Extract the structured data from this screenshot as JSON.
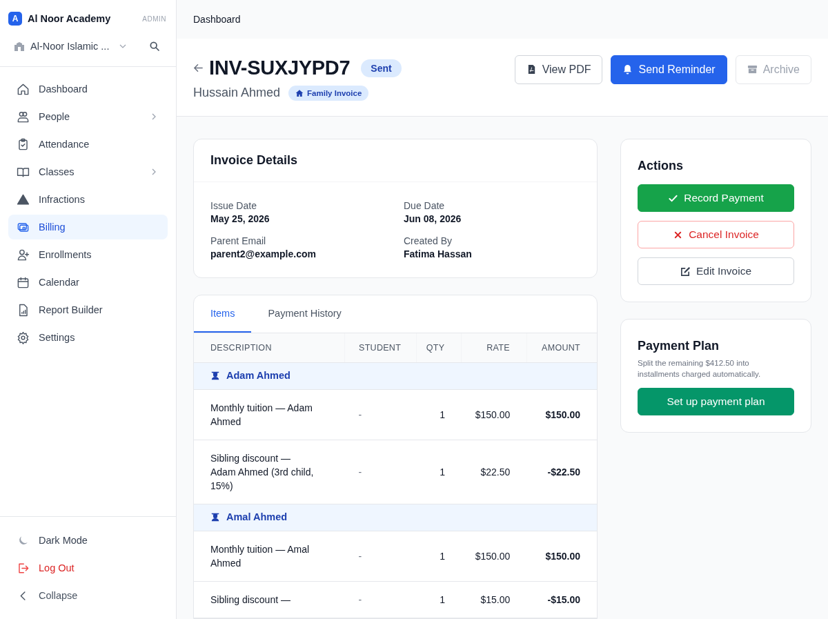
{
  "brand": {
    "logo": "A",
    "name": "Al Noor Academy",
    "role": "ADMIN"
  },
  "school": {
    "name": "Al-Noor Islamic ..."
  },
  "nav": [
    {
      "label": "Dashboard",
      "selected": false,
      "submenu": false
    },
    {
      "label": "People",
      "selected": false,
      "submenu": true
    },
    {
      "label": "Attendance",
      "selected": false,
      "submenu": false
    },
    {
      "label": "Classes",
      "selected": false,
      "submenu": true
    },
    {
      "label": "Infractions",
      "selected": false,
      "submenu": false
    },
    {
      "label": "Billing",
      "selected": true,
      "submenu": false
    },
    {
      "label": "Enrollments",
      "selected": false,
      "submenu": false
    },
    {
      "label": "Calendar",
      "selected": false,
      "submenu": false
    },
    {
      "label": "Report Builder",
      "selected": false,
      "submenu": false
    },
    {
      "label": "Settings",
      "selected": false,
      "submenu": false
    }
  ],
  "footer_nav": [
    {
      "label": "Dark Mode",
      "kind": "normal"
    },
    {
      "label": "Log Out",
      "kind": "danger"
    },
    {
      "label": "Collapse",
      "kind": "muted"
    }
  ],
  "breadcrumb": "Dashboard",
  "invoice": {
    "number": "INV-SUXJYPD7",
    "status": "Sent",
    "customer": "Hussain Ahmed",
    "type_badge": "Family Invoice"
  },
  "header_actions": [
    {
      "label": "View PDF",
      "kind": "outline",
      "disabled": false
    },
    {
      "label": "Send Reminder",
      "kind": "primary",
      "disabled": false
    },
    {
      "label": "Archive",
      "kind": "outline",
      "disabled": true
    }
  ],
  "details": {
    "title": "Invoice Details",
    "fields": [
      {
        "label": "Issue Date",
        "value": "May 25, 2026"
      },
      {
        "label": "Due Date",
        "value": "Jun 08, 2026"
      },
      {
        "label": "Parent Email",
        "value": "parent2@example.com"
      },
      {
        "label": "Created By",
        "value": "Fatima Hassan"
      }
    ]
  },
  "tabs": [
    {
      "label": "Items",
      "selected": true
    },
    {
      "label": "Payment History",
      "selected": false
    }
  ],
  "table": {
    "columns": [
      "DESCRIPTION",
      "STUDENT",
      "QTY",
      "RATE",
      "AMOUNT"
    ],
    "groups": [
      {
        "student": "Adam Ahmed",
        "rows": [
          {
            "description": "Monthly tuition — Adam Ahmed",
            "student": "-",
            "qty": "1",
            "rate": "$150.00",
            "amount": "$150.00"
          },
          {
            "description": "Sibling discount — Adam Ahmed (3rd child, 15%)",
            "student": "-",
            "qty": "1",
            "rate": "$22.50",
            "amount": "-$22.50"
          }
        ]
      },
      {
        "student": "Amal Ahmed",
        "rows": [
          {
            "description": "Monthly tuition — Amal Ahmed",
            "student": "-",
            "qty": "1",
            "rate": "$150.00",
            "amount": "$150.00"
          },
          {
            "description": "Sibling discount —",
            "student": "-",
            "qty": "1",
            "rate": "$15.00",
            "amount": "-$15.00"
          }
        ]
      }
    ]
  },
  "actions": {
    "title": "Actions",
    "buttons": [
      {
        "label": "Record Payment",
        "kind": "success"
      },
      {
        "label": "Cancel Invoice",
        "kind": "danger"
      },
      {
        "label": "Edit Invoice",
        "kind": "outline"
      }
    ]
  },
  "payment_plan": {
    "title": "Payment Plan",
    "text": "Split the remaining $412.50 into installments charged automatically.",
    "button": "Set up payment plan"
  }
}
